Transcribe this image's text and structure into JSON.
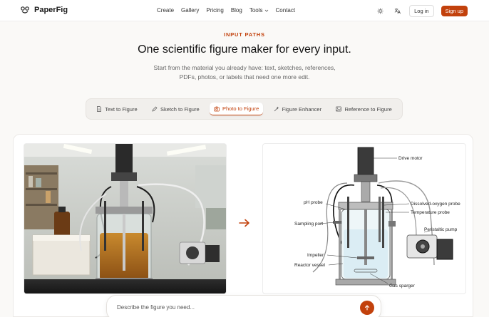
{
  "brand": {
    "name": "PaperFig"
  },
  "nav": {
    "links": [
      {
        "label": "Create"
      },
      {
        "label": "Gallery"
      },
      {
        "label": "Pricing"
      },
      {
        "label": "Blog"
      },
      {
        "label": "Tools",
        "chevron": "chevron-down-icon"
      },
      {
        "label": "Contact"
      }
    ],
    "login_label": "Log in",
    "signup_label": "Sign up"
  },
  "hero": {
    "eyebrow": "INPUT PATHS",
    "headline": "One scientific figure maker for every input.",
    "subline": "Start from the material you already have: text, sketches, references, PDFs, photos, or labels that need one more edit."
  },
  "tabs": [
    {
      "label": "Text to Figure",
      "icon": "document-icon",
      "active": false
    },
    {
      "label": "Sketch to Figure",
      "icon": "pencil-icon",
      "active": false
    },
    {
      "label": "Photo to Figure",
      "icon": "camera-icon",
      "active": true
    },
    {
      "label": "Figure Enhancer",
      "icon": "sparkle-icon",
      "active": false
    },
    {
      "label": "Reference to Figure",
      "icon": "image-icon",
      "active": false
    }
  ],
  "diagram": {
    "labels": {
      "drive_motor": "Drive motor",
      "ph_probe": "pH probe",
      "do_probe": "Dissolved-oxygen probe",
      "temp_probe": "Temperature probe",
      "sampling_port": "Sampling port",
      "peristaltic_pump": "Peristaltic pump",
      "impeller": "Impeller",
      "reactor_vessel": "Reactor vessel",
      "gas_sparger": "Gas sparger"
    }
  },
  "prompt": {
    "placeholder": "Describe the figure you need..."
  },
  "colors": {
    "accent": "#c2410c",
    "background": "#faf9f7"
  }
}
